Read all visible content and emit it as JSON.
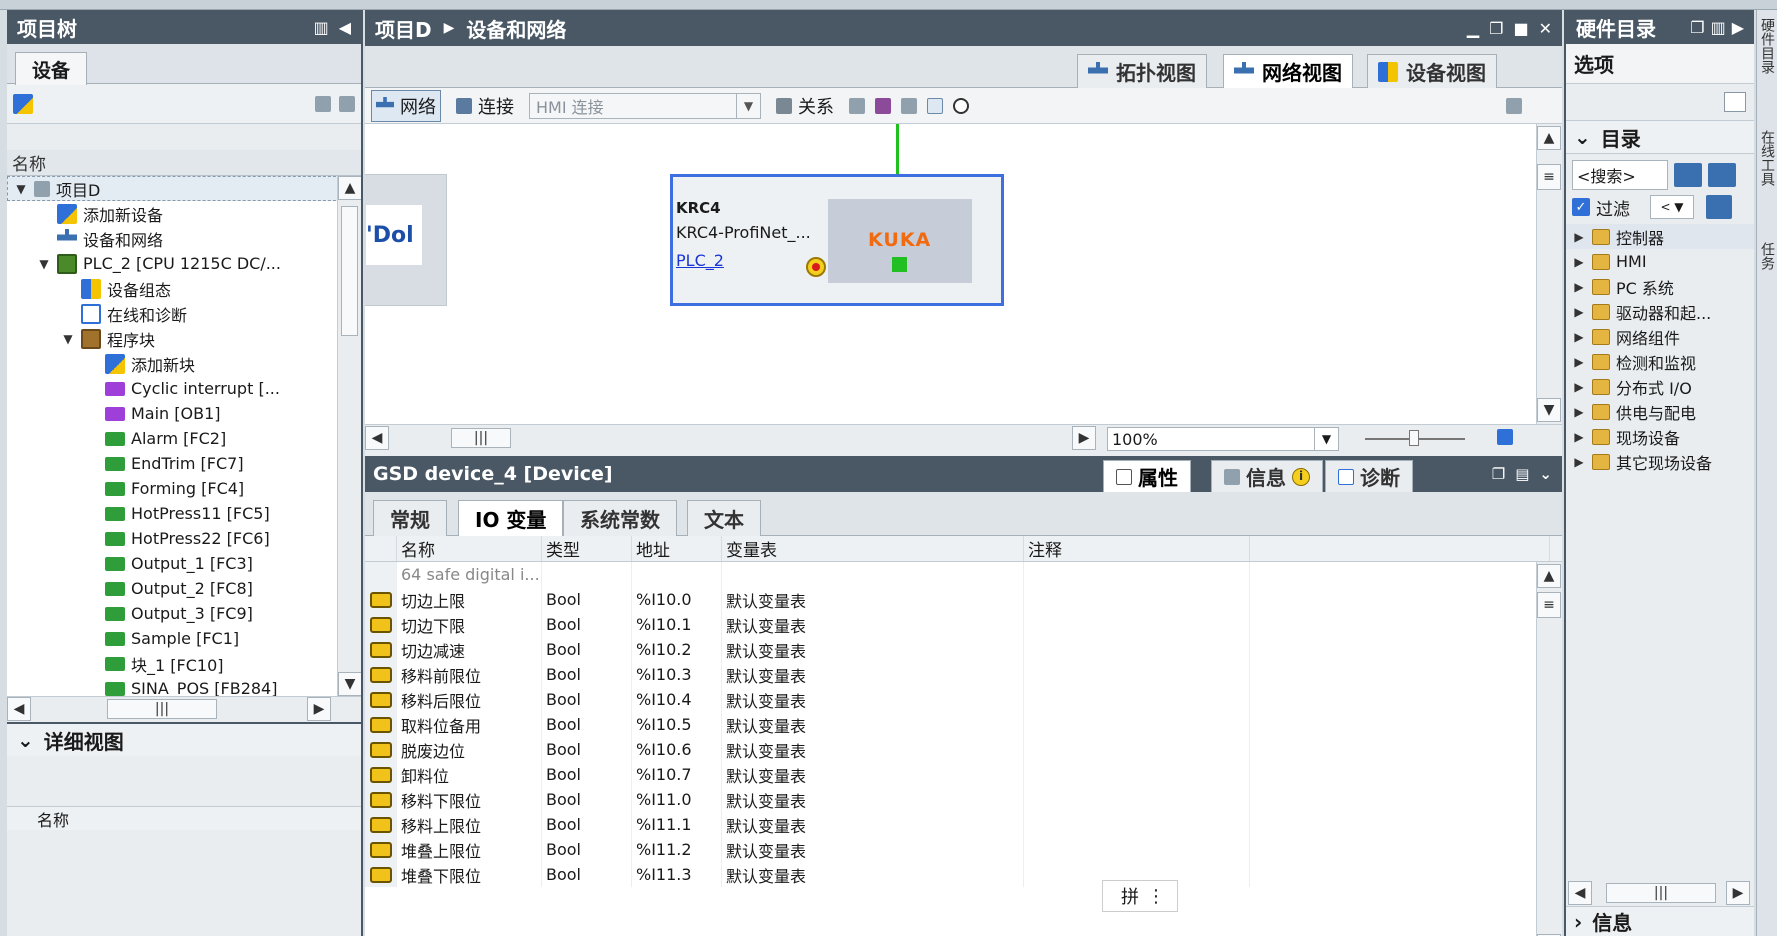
{
  "project_tree": {
    "title": "项目树",
    "tab": "设备",
    "column_header": "名称",
    "items": [
      {
        "label": "项目D",
        "level": 0,
        "expanded": true,
        "icon": "project-icon",
        "selected": true
      },
      {
        "label": "添加新设备",
        "level": 1,
        "icon": "add-device-icon"
      },
      {
        "label": "设备和网络",
        "level": 1,
        "icon": "network-icon"
      },
      {
        "label": "PLC_2 [CPU 1215C DC/...",
        "level": 1,
        "expanded": true,
        "icon": "plc-icon"
      },
      {
        "label": "设备组态",
        "level": 2,
        "icon": "device-config-icon"
      },
      {
        "label": "在线和诊断",
        "level": 2,
        "icon": "diagnostics-icon"
      },
      {
        "label": "程序块",
        "level": 2,
        "expanded": true,
        "icon": "program-blocks-icon"
      },
      {
        "label": "添加新块",
        "level": 3,
        "icon": "add-block-icon"
      },
      {
        "label": "Cyclic interrupt [...",
        "level": 3,
        "icon": "ob-icon"
      },
      {
        "label": "Main [OB1]",
        "level": 3,
        "icon": "ob-icon"
      },
      {
        "label": "Alarm [FC2]",
        "level": 3,
        "icon": "fc-icon"
      },
      {
        "label": "EndTrim [FC7]",
        "level": 3,
        "icon": "fc-icon"
      },
      {
        "label": "Forming [FC4]",
        "level": 3,
        "icon": "fc-icon"
      },
      {
        "label": "HotPress11 [FC5]",
        "level": 3,
        "icon": "fc-icon"
      },
      {
        "label": "HotPress22 [FC6]",
        "level": 3,
        "icon": "fc-icon"
      },
      {
        "label": "Output_1 [FC3]",
        "level": 3,
        "icon": "fc-icon"
      },
      {
        "label": "Output_2 [FC8]",
        "level": 3,
        "icon": "fc-icon"
      },
      {
        "label": "Output_3 [FC9]",
        "level": 3,
        "icon": "fc-icon"
      },
      {
        "label": "Sample [FC1]",
        "level": 3,
        "icon": "fc-icon"
      },
      {
        "label": "块_1 [FC10]",
        "level": 3,
        "icon": "fc-icon"
      },
      {
        "label": "SINA_POS [FB284]",
        "level": 3,
        "icon": "fc-icon"
      }
    ],
    "detail_view": "详细视图",
    "detail_column": "名称"
  },
  "editor": {
    "breadcrumb": [
      "项目D",
      "设备和网络"
    ],
    "view_tabs": [
      {
        "label": "拓扑视图",
        "active": false
      },
      {
        "label": "网络视图",
        "active": true
      },
      {
        "label": "设备视图",
        "active": false
      }
    ],
    "toolbar": {
      "network": "网络",
      "connect": "连接",
      "connection_type": "HMI 连接",
      "relations": "关系"
    },
    "canvas": {
      "left_device_logo": "'Dol",
      "krc4": {
        "name": "KRC4",
        "type": "KRC4-ProfiNet_...",
        "controller_link": "PLC_2",
        "brand": "KUKA"
      }
    },
    "zoom": "100%"
  },
  "properties": {
    "title": "GSD device_4 [Device]",
    "tabs": [
      {
        "label": "属性",
        "active": true
      },
      {
        "label": "信息",
        "active": false
      },
      {
        "label": "诊断",
        "active": false
      }
    ],
    "subtabs": [
      {
        "label": "常规",
        "active": false
      },
      {
        "label": "IO 变量",
        "active": true
      },
      {
        "label": "系统常数",
        "active": false
      },
      {
        "label": "文本",
        "active": false
      }
    ],
    "columns": [
      "名称",
      "类型",
      "地址",
      "变量表",
      "注释"
    ],
    "rows": [
      {
        "name": "64 safe digital i...",
        "type": "",
        "address": "",
        "table": "",
        "comment": "",
        "group": true
      },
      {
        "name": "切边上限",
        "type": "Bool",
        "address": "%I10.0",
        "table": "默认变量表",
        "comment": ""
      },
      {
        "name": "切边下限",
        "type": "Bool",
        "address": "%I10.1",
        "table": "默认变量表",
        "comment": ""
      },
      {
        "name": "切边减速",
        "type": "Bool",
        "address": "%I10.2",
        "table": "默认变量表",
        "comment": ""
      },
      {
        "name": "移料前限位",
        "type": "Bool",
        "address": "%I10.3",
        "table": "默认变量表",
        "comment": ""
      },
      {
        "name": "移料后限位",
        "type": "Bool",
        "address": "%I10.4",
        "table": "默认变量表",
        "comment": ""
      },
      {
        "name": "取料位备用",
        "type": "Bool",
        "address": "%I10.5",
        "table": "默认变量表",
        "comment": ""
      },
      {
        "name": "脱废边位",
        "type": "Bool",
        "address": "%I10.6",
        "table": "默认变量表",
        "comment": ""
      },
      {
        "name": "卸料位",
        "type": "Bool",
        "address": "%I10.7",
        "table": "默认变量表",
        "comment": ""
      },
      {
        "name": "移料下限位",
        "type": "Bool",
        "address": "%I11.0",
        "table": "默认变量表",
        "comment": ""
      },
      {
        "name": "移料上限位",
        "type": "Bool",
        "address": "%I11.1",
        "table": "默认变量表",
        "comment": ""
      },
      {
        "name": "堆叠上限位",
        "type": "Bool",
        "address": "%I11.2",
        "table": "默认变量表",
        "comment": ""
      },
      {
        "name": "堆叠下限位",
        "type": "Bool",
        "address": "%I11.3",
        "table": "默认变量表",
        "comment": ""
      }
    ],
    "ime_label": "拼"
  },
  "hardware_catalog": {
    "title": "硬件目录",
    "options": "选项",
    "catalog": "目录",
    "search_placeholder": "<搜索>",
    "filter": "过滤",
    "items": [
      {
        "label": "控制器",
        "selected": true
      },
      {
        "label": "HMI"
      },
      {
        "label": "PC 系统"
      },
      {
        "label": "驱动器和起..."
      },
      {
        "label": "网络组件"
      },
      {
        "label": "检测和监视"
      },
      {
        "label": "分布式 I/O"
      },
      {
        "label": "供电与配电"
      },
      {
        "label": "现场设备"
      },
      {
        "label": "其它现场设备"
      }
    ],
    "info": "信息"
  },
  "side_tabs": [
    "硬件目录",
    "在线工具",
    "任务"
  ],
  "colors": {
    "titlebar": "#4a5865",
    "selection_border": "#3d6fe0",
    "network_line": "#1ec11e",
    "kuka": "#f26a10",
    "link": "#1a35d6"
  }
}
